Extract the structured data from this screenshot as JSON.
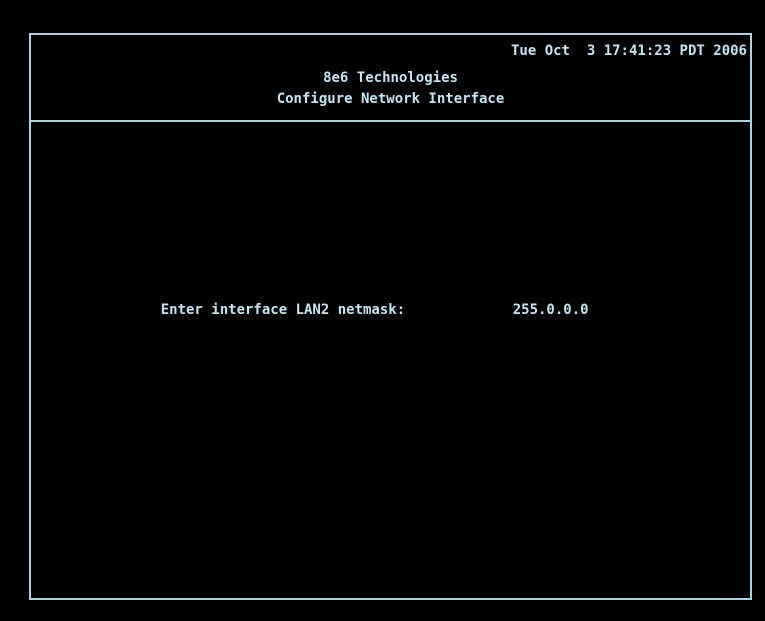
{
  "header": {
    "datetime": "Tue Oct  3 17:41:23 PDT 2006",
    "company": "8e6 Technologies",
    "title": "Configure Network Interface"
  },
  "prompt": {
    "label": "Enter interface LAN2 netmask:",
    "value": "255.0.0.0"
  },
  "colors": {
    "background": "#000000",
    "text": "#c3e6f5",
    "border": "#a9d3e3"
  }
}
